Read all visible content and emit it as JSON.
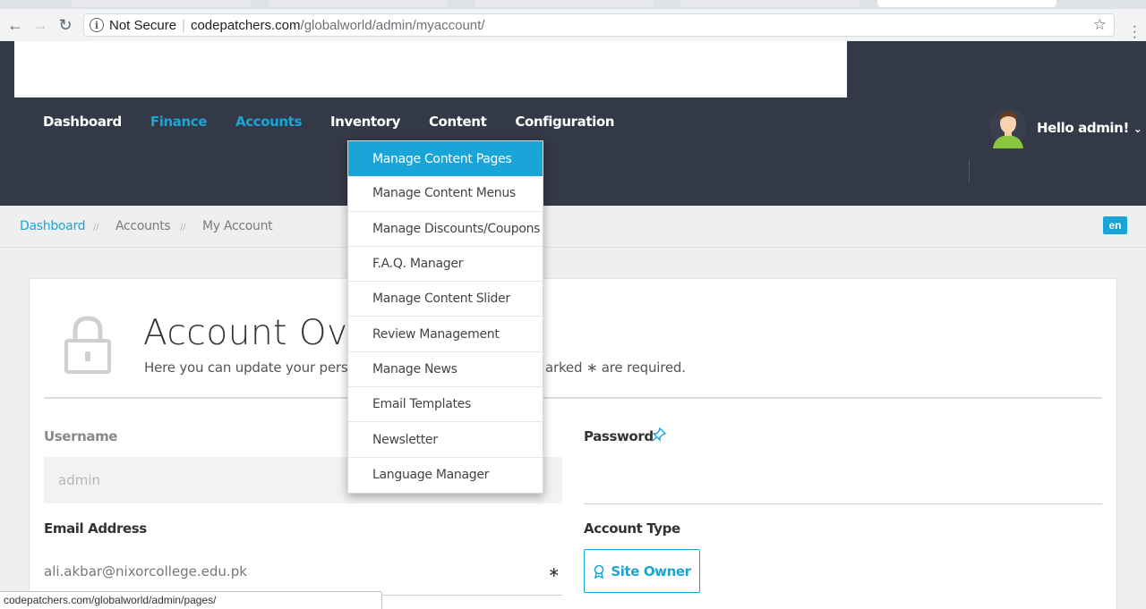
{
  "browser": {
    "security_label": "Not Secure",
    "url_domain": "codepatchers.com",
    "url_path": "/globalworld/admin/myaccount/",
    "status_url": "codepatchers.com/globalworld/admin/pages/"
  },
  "nav": {
    "items": [
      {
        "label": "Dashboard",
        "active": false
      },
      {
        "label": "Finance",
        "active": true
      },
      {
        "label": "Accounts",
        "active": true
      },
      {
        "label": "Inventory",
        "active": false
      },
      {
        "label": "Content",
        "active": false
      },
      {
        "label": "Configuration",
        "active": false
      }
    ]
  },
  "user": {
    "greeting": "Hello admin!"
  },
  "dropdown": {
    "items": [
      "Manage Content Pages",
      "Manage Content Menus",
      "Manage Discounts/Coupons",
      "F.A.Q. Manager",
      "Manage Content Slider",
      "Review Management",
      "Manage News",
      "Email Templates",
      "Newsletter",
      "Language Manager"
    ]
  },
  "breadcrumb": {
    "items": [
      "Dashboard",
      "Accounts",
      "My Account"
    ],
    "separator": "//",
    "language": "en"
  },
  "page": {
    "title": "Account Over",
    "subtitle_left": "Here you can update your perso",
    "subtitle_right": "arked ∗ are required."
  },
  "form": {
    "username_label": "Username",
    "username_value": "admin",
    "password_label": "Password",
    "email_label": "Email Address",
    "email_value": "ali.akbar@nixorcollege.edu.pk",
    "required_mark": "∗",
    "account_type_label": "Account Type",
    "account_type_value": "Site Owner"
  },
  "colors": {
    "accent": "#1aa5d8",
    "header_bg": "#343947"
  }
}
